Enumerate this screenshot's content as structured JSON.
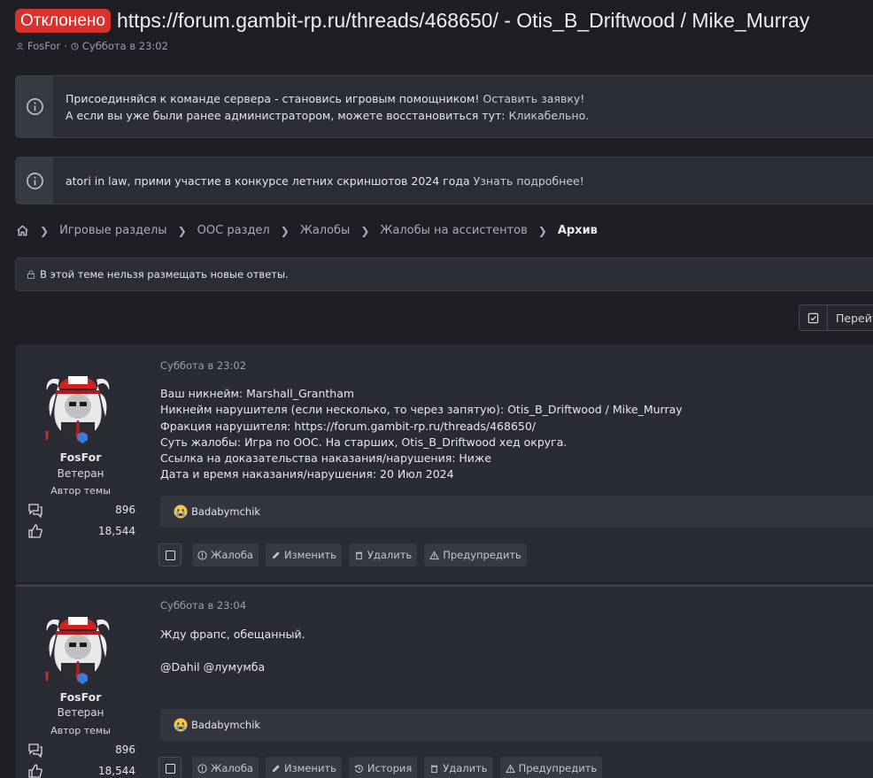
{
  "thread": {
    "label": "Отклонено",
    "title": "https://forum.gambit-rp.ru/threads/468650/ - Otis_B_Driftwood / Mike_Murray",
    "author": "FosFor",
    "sep": "·",
    "date": "Суббота в 23:02"
  },
  "notices": [
    {
      "line1": "Присоединяйся к команде сервера - становись игровым помощником!",
      "line1_link": "Оставить заявку!",
      "line2": "А если вы уже были ранее администратором, можете восстановиться тут:",
      "line2_link": "Кликабельно."
    },
    {
      "text": "atori in law, прими участие в конкурсе летних скриншотов 2024 года",
      "link": "Узнать подробнее!"
    }
  ],
  "breadcrumbs": [
    "Игровые разделы",
    "OOC раздел",
    "Жалобы",
    "Жалобы на ассистентов"
  ],
  "breadcrumb_current": "Архив",
  "locked_notice": "В этой теме нельзя размещать новые ответы.",
  "goto_label": "Перейти",
  "colors": {
    "label_bg": "#d9322e",
    "background": "#1e1f24",
    "post_bg": "#2a2c33"
  },
  "posts": [
    {
      "user": {
        "name": "FosFor",
        "rank": "Ветеран",
        "role": "Автор темы",
        "messages": "896",
        "likes": "18,544"
      },
      "time": "Суббота в 23:02",
      "body": [
        "Ваш никнейм: Marshall_Grantham",
        "Никнейм нарушителя (если несколько, то через запятую): Otis_B_Driftwood / Mike_Murray",
        "Фракция нарушителя: https://forum.gambit-rp.ru/threads/468650/",
        "Суть жалобы: Игра по OOC. На старших, Otis_B_Driftwood хед округа.",
        "Ссылка на доказательства наказания/нарушения: Ниже",
        "Дата и время наказания/нарушения: 20 Июл 2024"
      ],
      "reaction_user": "Badabymchik",
      "actions": [
        "Жалоба",
        "Изменить",
        "Удалить",
        "Предупредить"
      ]
    },
    {
      "user": {
        "name": "FosFor",
        "rank": "Ветеран",
        "role": "Автор темы",
        "messages": "896",
        "likes": "18,544"
      },
      "time": "Суббота в 23:04",
      "body": [
        "Жду фрапс, обещанный.",
        "",
        "@Dahil @лумумба"
      ],
      "reaction_user": "Badabymchik",
      "actions": [
        "Жалоба",
        "Изменить",
        "История",
        "Удалить",
        "Предупредить"
      ]
    }
  ],
  "icons": [
    "user-icon",
    "clock-icon",
    "info-icon",
    "home-icon",
    "lock-icon",
    "select-icon",
    "messages-icon",
    "likes-icon",
    "crying-emoji-icon",
    "report-icon",
    "edit-icon",
    "history-icon",
    "delete-icon",
    "warn-icon"
  ]
}
